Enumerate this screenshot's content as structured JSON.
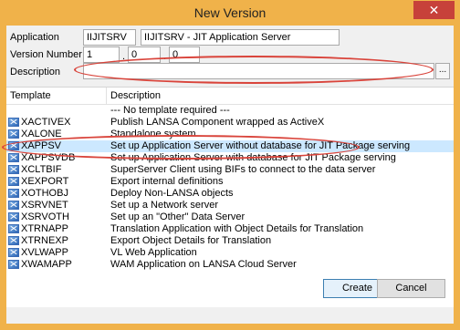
{
  "window": {
    "title": "New Version",
    "close_glyph": "✕"
  },
  "form": {
    "application_label": "Application",
    "application_value": "IIJITSRV",
    "application_desc_value": "IIJITSRV - JIT Application Server",
    "version_label": "Version Number",
    "version_major": "1",
    "version_minor": "0",
    "version_patch": "0",
    "version_separator": ".",
    "description_label": "Description",
    "description_value": "",
    "ellipsis_label": "..."
  },
  "list": {
    "columns": [
      "Template",
      "Description"
    ],
    "rows": [
      {
        "name": "",
        "desc": "--- No template required ---",
        "icon": "none"
      },
      {
        "name": "XACTIVEX",
        "desc": "Publish LANSA Component wrapped as ActiveX",
        "icon": "template-icon"
      },
      {
        "name": "XALONE",
        "desc": "Standalone system",
        "icon": "template-icon"
      },
      {
        "name": "XAPPSV",
        "desc": "Set up Application Server without database for JIT Package serving",
        "icon": "template-icon",
        "selected": true
      },
      {
        "name": "XAPPSVDB",
        "desc": "Set up Application Server with database for JIT Package serving",
        "icon": "template-icon"
      },
      {
        "name": "XCLTBIF",
        "desc": "SuperServer Client using BIFs to connect to the data server",
        "icon": "template-icon"
      },
      {
        "name": "XEXPORT",
        "desc": "Export internal definitions",
        "icon": "template-icon"
      },
      {
        "name": "XOTHOBJ",
        "desc": "Deploy Non-LANSA objects",
        "icon": "template-icon"
      },
      {
        "name": "XSRVNET",
        "desc": "Set up a Network server",
        "icon": "template-icon"
      },
      {
        "name": "XSRVOTH",
        "desc": "Set up an \"Other\" Data Server",
        "icon": "template-icon"
      },
      {
        "name": "XTRNAPP",
        "desc": "Translation Application with Object Details for Translation",
        "icon": "template-icon"
      },
      {
        "name": "XTRNEXP",
        "desc": "Export Object Details for Translation",
        "icon": "template-icon"
      },
      {
        "name": "XVLWAPP",
        "desc": "VL Web Application",
        "icon": "template-icon"
      },
      {
        "name": "XWAMAPP",
        "desc": "WAM Application on LANSA Cloud Server",
        "icon": "template-icon"
      }
    ]
  },
  "buttons": {
    "create": "Create",
    "cancel": "Cancel"
  },
  "colors": {
    "titlebar": "#f0b24a",
    "close": "#c7413a",
    "selection": "#cce8ff",
    "annotation": "#d9443b"
  }
}
